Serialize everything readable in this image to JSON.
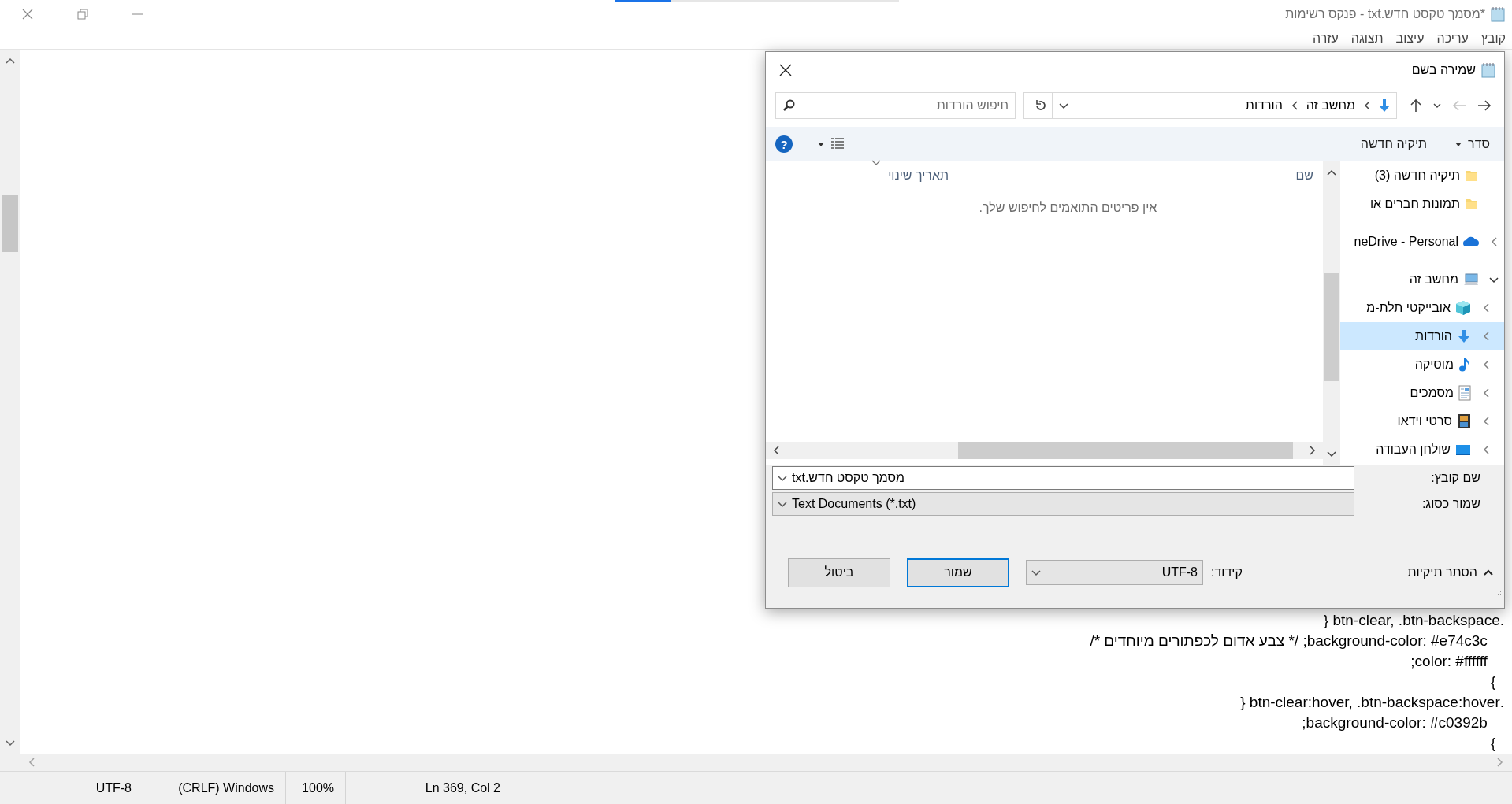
{
  "window": {
    "title": "*מסמך טקסט חדש.txt - פנקס רשימות"
  },
  "menu": [
    "קובץ",
    "עריכה",
    "עיצוב",
    "תצוגה",
    "עזרה"
  ],
  "editor": {
    "lines": [
      ".btn-clear, .btn-backspace {",
      "    background-color: #e74c3c; /* צבע אדום לכפתורים מיוחדים */",
      "    color: #ffffff;",
      "  }",
      ".btn-clear:hover, .btn-backspace:hover {",
      "    background-color: #c0392b;",
      "  }"
    ]
  },
  "status_bar": [
    "Ln 369, Col 2",
    "100%",
    "(CRLF) Windows",
    "UTF-8"
  ],
  "dialog": {
    "title": "שמירה בשם",
    "nav_buttons": [
      {
        "kind": "back",
        "disabled": false
      },
      {
        "kind": "forward",
        "disabled": true
      },
      {
        "kind": "recent",
        "disabled": false
      },
      {
        "kind": "up",
        "disabled": false
      }
    ],
    "address": [
      "מחשב זה",
      "הורדות"
    ],
    "search": {
      "placeholder": "חיפוש הורדות"
    },
    "toolbar": {
      "organize": "סדר",
      "new_folder": "תיקיה חדשה",
      "help": "?"
    },
    "nav_pane": [
      {
        "label": "תיקיה חדשה (3)",
        "kind": "folder",
        "selected": false
      },
      {
        "label": "תמונות חברים או",
        "kind": "folder",
        "selected": false
      },
      {
        "label": "neDrive - Personal",
        "kind": "cloud",
        "expanded": false,
        "selected": false
      },
      {
        "label": "מחשב זה",
        "kind": "computer",
        "expanded": true,
        "selected": false,
        "children": [
          {
            "label": "אובייקטי תלת-מ",
            "kind": "cube",
            "expanded": false,
            "selected": false
          },
          {
            "label": "הורדות",
            "kind": "download",
            "expanded": false,
            "selected": true
          },
          {
            "label": "מוסיקה",
            "kind": "music",
            "expanded": false,
            "selected": false
          },
          {
            "label": "מסמכים",
            "kind": "document",
            "expanded": false,
            "selected": false
          },
          {
            "label": "סרטי וידאו",
            "kind": "video",
            "expanded": false,
            "selected": false
          },
          {
            "label": "שולחן העבודה",
            "kind": "desktop",
            "expanded": false,
            "selected": false
          }
        ]
      }
    ],
    "columns": [
      {
        "label": "שם",
        "sorted": false
      },
      {
        "label": "תאריך שינוי",
        "sorted": true
      }
    ],
    "empty_message": "אין פריטים התואמים לחיפוש שלך.",
    "file_name": {
      "label": "שם קובץ:",
      "value": "מסמך טקסט חדש.txt"
    },
    "save_type": {
      "label": "שמור כסוג:",
      "value": "Text Documents (*.txt)"
    },
    "hide_folders": "הסתר תיקיות",
    "encoding": {
      "label": "קידוד:",
      "value": "UTF-8"
    },
    "buttons": [
      {
        "label": "שמור",
        "default": true
      },
      {
        "label": "ביטול",
        "default": false
      }
    ]
  }
}
